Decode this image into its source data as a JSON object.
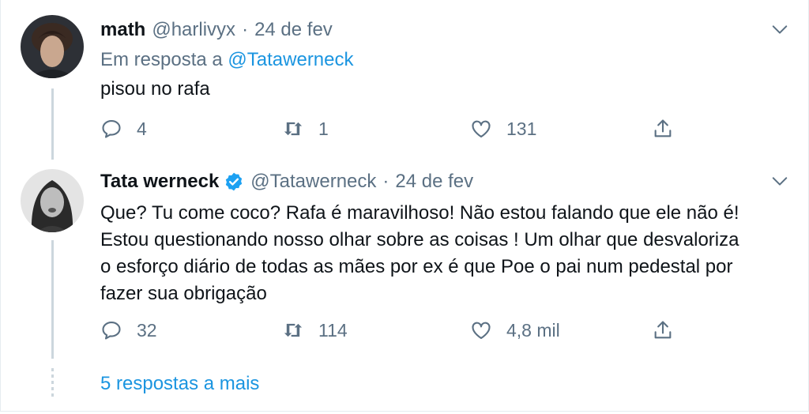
{
  "tweets": [
    {
      "name": "math",
      "handle": "@harlivyx",
      "separator": "·",
      "date": "24 de fev",
      "reply_prefix": "Em resposta a",
      "reply_handle": "@Tatawerneck",
      "text": "pisou no rafa",
      "replies": "4",
      "retweets": "1",
      "likes": "131"
    },
    {
      "name": "Tata werneck",
      "verified": true,
      "handle": "@Tatawerneck",
      "separator": "·",
      "date": "24 de fev",
      "text_lines": [
        "Que? Tu come coco? Rafa é maravilhoso! Não estou falando que ele não é!",
        "Estou questionando nosso olhar sobre as coisas ! Um olhar que desvaloriza",
        "o esforço diário de todas as mães por ex é que Poe o pai num pedestal por",
        "fazer sua obrigação"
      ],
      "replies": "32",
      "retweets": "114",
      "likes": "4,8 mil"
    }
  ],
  "more_replies": "5 respostas a mais",
  "colors": {
    "link": "#1b95e0",
    "muted": "#5b7083",
    "verified": "#1da1f2",
    "line": "#ccd6dd"
  },
  "icons": [
    "chevron-down-icon",
    "reply-icon",
    "retweet-icon",
    "like-icon",
    "share-icon",
    "verified-icon"
  ]
}
